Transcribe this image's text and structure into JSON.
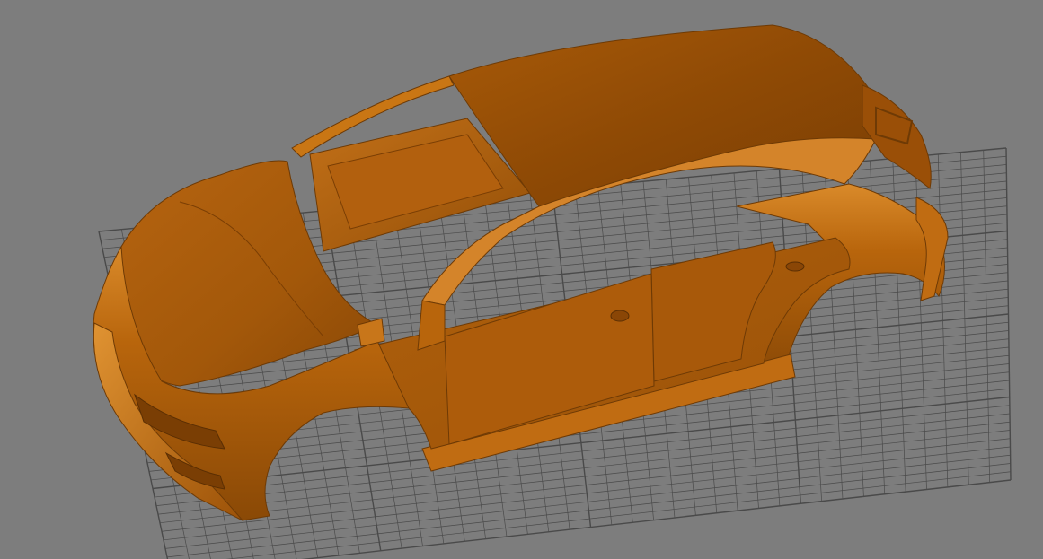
{
  "viewport": {
    "background_color": "#7d7d7d",
    "grid_line_color": "#4a4a4a",
    "grid_on": true,
    "model_color": "#b8650c",
    "model_highlight_color": "#d98a2a",
    "model_shadow_color": "#6e3a05",
    "model_name": "car-body-shell",
    "view": "perspective"
  }
}
